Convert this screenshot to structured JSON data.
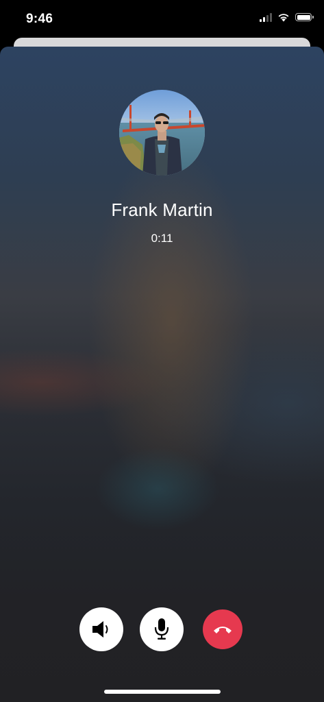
{
  "status_bar": {
    "time": "9:46",
    "icons": [
      "cellular-signal-icon",
      "wifi-icon",
      "battery-icon"
    ]
  },
  "call": {
    "caller_name": "Frank Martin",
    "duration": "0:11",
    "avatar": "caller-photo-avatar"
  },
  "controls": [
    {
      "name": "speaker",
      "icon": "speaker-icon",
      "color": "#ffffff"
    },
    {
      "name": "mute",
      "icon": "microphone-icon",
      "color": "#ffffff"
    },
    {
      "name": "end-call",
      "icon": "hang-up-icon",
      "color": "#e6394f"
    }
  ],
  "colors": {
    "end_call": "#e6394f",
    "background_top": "#2d4361",
    "background_bottom": "#212124"
  }
}
